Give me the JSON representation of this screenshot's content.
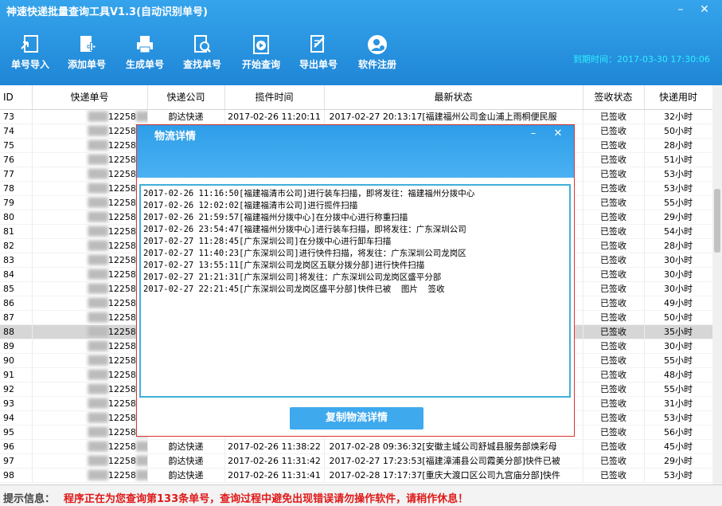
{
  "window": {
    "title": "神速快递批量查询工具V1.3(自动识别单号)",
    "minimize_label": "–",
    "close_label": "✕"
  },
  "toolbar": {
    "buttons": [
      {
        "label": "单号导入",
        "icon": "import-icon"
      },
      {
        "label": "添加单号",
        "icon": "add-document-icon"
      },
      {
        "label": "生成单号",
        "icon": "printer-icon"
      },
      {
        "label": "查找单号",
        "icon": "search-document-icon"
      },
      {
        "label": "开始查询",
        "icon": "play-icon"
      },
      {
        "label": "导出单号",
        "icon": "export-icon"
      },
      {
        "label": "软件注册",
        "icon": "register-user-icon"
      }
    ],
    "expire_text": "到期时间：2017-03-30 17:30:06"
  },
  "table": {
    "headers": [
      "ID",
      "快递单号",
      "快递公司",
      "揽件时间",
      "最新状态",
      "签收状态",
      "快递用时"
    ],
    "rows": [
      {
        "id": "73",
        "no": "12258",
        "co": "韵达快递",
        "tm": "2017-02-26 11:20:11",
        "st": "2017-02-27  20:13:17[福建福州公司金山浦上雨桐便民服",
        "sg": "已签收",
        "du": "32小时"
      },
      {
        "id": "74",
        "no": "12258",
        "co": "韵达快递",
        "tm": "",
        "st": "",
        "sg": "已签收",
        "du": "50小时"
      },
      {
        "id": "75",
        "no": "12258",
        "co": "",
        "tm": "",
        "st": "",
        "sg": "已签收",
        "du": "28小时"
      },
      {
        "id": "76",
        "no": "12258",
        "co": "",
        "tm": "",
        "st": "",
        "sg": "已签收",
        "du": "51小时"
      },
      {
        "id": "77",
        "no": "12258",
        "co": "",
        "tm": "",
        "st": "",
        "sg": "已签收",
        "du": "53小时"
      },
      {
        "id": "78",
        "no": "12258",
        "co": "",
        "tm": "",
        "st": "",
        "sg": "已签收",
        "du": "53小时"
      },
      {
        "id": "79",
        "no": "12258",
        "co": "",
        "tm": "",
        "st": "",
        "sg": "已签收",
        "du": "55小时"
      },
      {
        "id": "80",
        "no": "12258",
        "co": "",
        "tm": "",
        "st": "",
        "sg": "已签收",
        "du": "29小时"
      },
      {
        "id": "81",
        "no": "12258",
        "co": "",
        "tm": "",
        "st": "",
        "sg": "已签收",
        "du": "54小时"
      },
      {
        "id": "82",
        "no": "12258",
        "co": "",
        "tm": "",
        "st": "",
        "sg": "已签收",
        "du": "28小时"
      },
      {
        "id": "83",
        "no": "12258",
        "co": "",
        "tm": "",
        "st": "",
        "sg": "已签收",
        "du": "30小时"
      },
      {
        "id": "84",
        "no": "12258",
        "co": "",
        "tm": "",
        "st": "",
        "sg": "已签收",
        "du": "30小时"
      },
      {
        "id": "85",
        "no": "12258",
        "co": "",
        "tm": "",
        "st": "",
        "sg": "已签收",
        "du": "30小时"
      },
      {
        "id": "86",
        "no": "12258",
        "co": "",
        "tm": "",
        "st": "",
        "sg": "已签收",
        "du": "49小时"
      },
      {
        "id": "87",
        "no": "12258",
        "co": "",
        "tm": "",
        "st": "",
        "sg": "已签收",
        "du": "50小时"
      },
      {
        "id": "88",
        "no": "12258",
        "co": "",
        "tm": "",
        "st": "",
        "sg": "已签收",
        "du": "35小时"
      },
      {
        "id": "89",
        "no": "12258",
        "co": "",
        "tm": "",
        "st": "",
        "sg": "已签收",
        "du": "30小时"
      },
      {
        "id": "90",
        "no": "12258",
        "co": "",
        "tm": "",
        "st": "",
        "sg": "已签收",
        "du": "55小时"
      },
      {
        "id": "91",
        "no": "12258",
        "co": "",
        "tm": "",
        "st": "",
        "sg": "已签收",
        "du": "48小时"
      },
      {
        "id": "92",
        "no": "12258",
        "co": "",
        "tm": "",
        "st": "",
        "sg": "已签收",
        "du": "55小时"
      },
      {
        "id": "93",
        "no": "12258",
        "co": "",
        "tm": "",
        "st": "",
        "sg": "已签收",
        "du": "31小时"
      },
      {
        "id": "94",
        "no": "12258",
        "co": "",
        "tm": "",
        "st": "",
        "sg": "已签收",
        "du": "53小时"
      },
      {
        "id": "95",
        "no": "12258",
        "co": "",
        "tm": "",
        "st": "",
        "sg": "已签收",
        "du": "56小时"
      },
      {
        "id": "96",
        "no": "12258",
        "co": "韵达快递",
        "tm": "2017-02-26 11:38:22",
        "st": "2017-02-28  09:36:32[安徽主城公司舒城县服务部焕彩母",
        "sg": "已签收",
        "du": "45小时"
      },
      {
        "id": "97",
        "no": "12258",
        "co": "韵达快递",
        "tm": "2017-02-26 11:31:42",
        "st": "2017-02-27  17:23:53[福建漳浦县公司霞美分部]快件已被",
        "sg": "已签收",
        "du": "29小时"
      },
      {
        "id": "98",
        "no": "12258",
        "co": "韵达快递",
        "tm": "2017-02-26 11:31:41",
        "st": "2017-02-28  17:17:37[重庆大渡口区公司九宫庙分部]快件",
        "sg": "已签收",
        "du": "53小时"
      }
    ],
    "selected_row_id": "88"
  },
  "dialog": {
    "title": "物流详情",
    "minimize_label": "–",
    "close_label": "✕",
    "log_lines": [
      "2017-02-26 11:16:50[福建福清市公司]进行装车扫描，即将发往：福建福州分拨中心",
      "2017-02-26 12:02:02[福建福清市公司]进行揽件扫描",
      "2017-02-26 21:59:57[福建福州分拨中心]在分拨中心进行称重扫描",
      "2017-02-26 23:54:47[福建福州分拨中心]进行装车扫描，即将发往：广东深圳公司",
      "2017-02-27 11:28:45[广东深圳公司]在分拨中心进行卸车扫描",
      "2017-02-27 11:40:23[广东深圳公司]进行快件扫描，将发往：广东深圳公司龙岗区",
      "2017-02-27 13:55:11[广东深圳公司龙岗区五联分拨分部]进行快件扫描",
      "2017-02-27 21:21:31[广东深圳公司]将发往：广东深圳公司龙岗区盛平分部",
      "2017-02-27 22:21:45[广东深圳公司龙岗区盛平分部]快件已被  图片  签收"
    ],
    "copy_button_label": "复制物流详情"
  },
  "status": {
    "label": "提示信息：",
    "text": "程序正在为您查询第133条单号，查询过程中避免出现错误请勿操作软件，请稍作休息！"
  },
  "colors": {
    "header_blue": "#2a94e0",
    "expire_cyan": "#2ef0ff",
    "status_red": "#e01818",
    "dialog_border": "#dd3333"
  }
}
